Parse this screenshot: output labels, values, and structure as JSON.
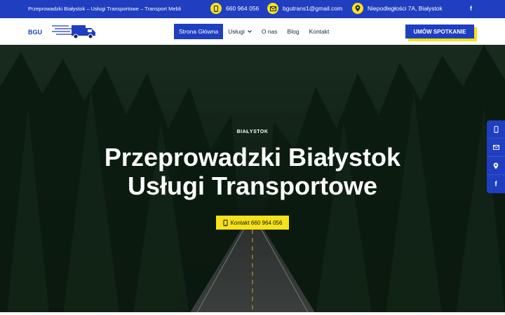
{
  "topbar": {
    "tagline": "Przeprowadzki Białystok – Usługi Transportowe – Transport Mebli",
    "phone": "660 964 056",
    "email": "bgutrans1@gmail.com",
    "address": "Niepodległości 7A, Białystok",
    "facebook": "f"
  },
  "logo": {
    "text": "BGU"
  },
  "nav": {
    "items": [
      {
        "label": "Strona Główna"
      },
      {
        "label": "Usługi"
      },
      {
        "label": "O nas"
      },
      {
        "label": "Blog"
      },
      {
        "label": "Kontakt"
      }
    ],
    "cta": "UMÓW SPOTKANIE"
  },
  "hero": {
    "kicker": "BIAŁYSTOK",
    "title_line1": "Przeprowadzki Białystok",
    "title_line2": "Usługi Transportowe",
    "button": "Kontakt 660 964 056"
  },
  "dock": {
    "facebook": "f"
  },
  "colors": {
    "primary": "#1f3ec0",
    "accent": "#f5e21b"
  }
}
